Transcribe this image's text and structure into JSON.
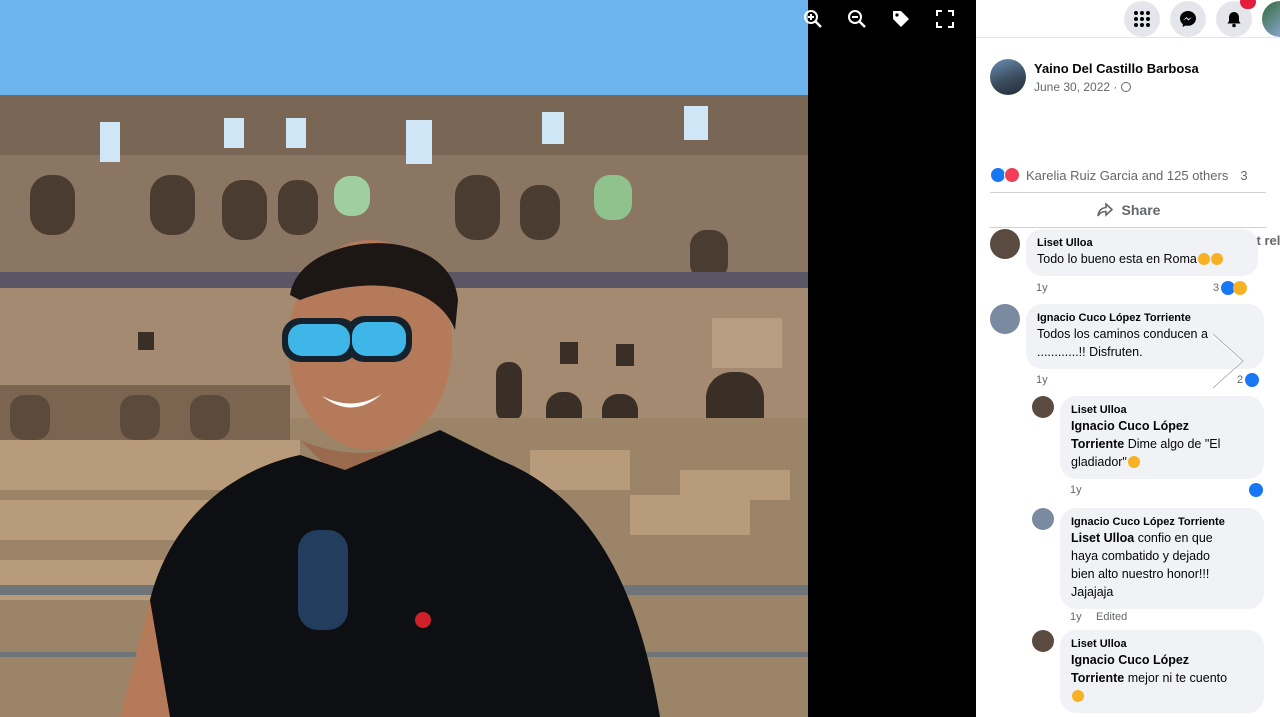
{
  "viewer": {
    "tools": [
      "zoom-in",
      "zoom-out",
      "tag",
      "fullscreen"
    ]
  },
  "topbar": {
    "notification_count": ""
  },
  "post": {
    "author": "Yaino Del Castillo Barbosa",
    "date": "June 30, 2022 ·",
    "reactions_text": "Karelia Ruiz Garcia and 125 others",
    "comment_count_partial": "3",
    "share_label": "Share",
    "sort_label": "Most relevan"
  },
  "comments": [
    {
      "name": "Liset Ulloa",
      "text": "Todo lo bueno esta en Roma",
      "time": "1y",
      "reactions": "3"
    },
    {
      "name": "Ignacio Cuco López Torriente",
      "text_line1": "Todos los caminos conducen a",
      "text_line2": "............!! Disfruten.",
      "time": "1y",
      "reactions": "2"
    },
    {
      "name": "Liset Ulloa",
      "mention": "Ignacio Cuco López Torriente",
      "mention_line1": "Ignacio Cuco López",
      "mention_line2": "Torriente",
      "text": " Dime algo de \"El",
      "text2": "gladiador\"",
      "time": "1y"
    },
    {
      "name": "Ignacio Cuco López Torriente",
      "mention": "Liset Ulloa",
      "text": " confio en que",
      "text2": "haya combatido y dejado",
      "text3": "bien alto nuestro honor!!!",
      "text4": "Jajajaja",
      "time": "1y",
      "edited": "Edited"
    },
    {
      "name": "Liset Ulloa",
      "mention_line1": "Ignacio Cuco López",
      "mention_line2": "Torriente",
      "text": " mejor ni te cuento"
    }
  ],
  "colors": {
    "facebook_blue": "#1877f2",
    "love_red": "#f33e58",
    "bubble_bg": "#f0f2f5",
    "secondary_text": "#65676b"
  }
}
